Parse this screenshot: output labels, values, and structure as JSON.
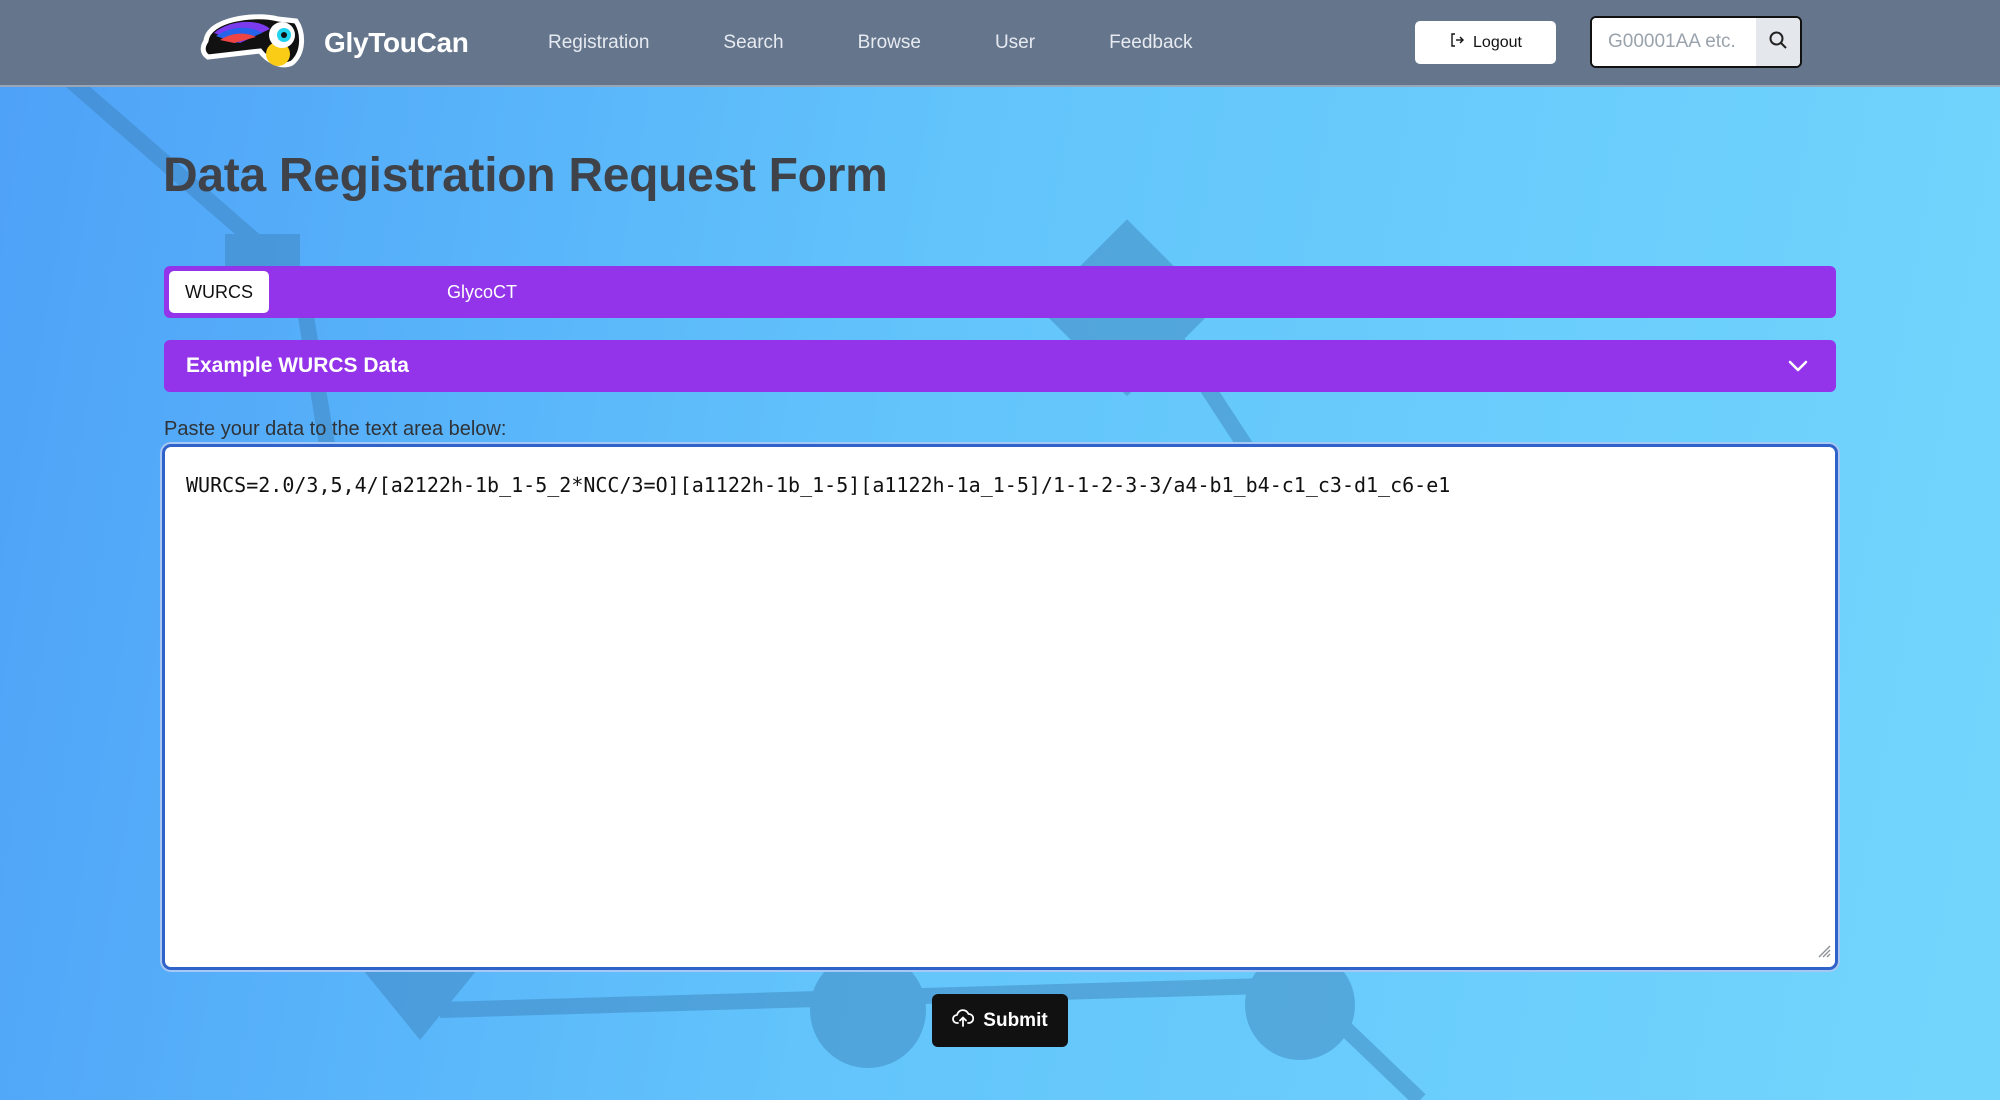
{
  "brand": {
    "name": "GlyTouCan",
    "logo_icon": "toucan-logo"
  },
  "nav": {
    "links": [
      "Registration",
      "Search",
      "Browse",
      "User",
      "Feedback"
    ],
    "logout_label": "Logout",
    "search_placeholder": "G00001AA etc."
  },
  "page": {
    "title": "Data Registration Request Form",
    "tabs": [
      {
        "label": "WURCS",
        "active": true
      },
      {
        "label": "GlycoCT",
        "active": false
      }
    ],
    "accordion_title": "Example WURCS Data",
    "paste_label": "Paste your data to the text area below:",
    "textarea_value": "WURCS=2.0/3,5,4/[a2122h-1b_1-5_2*NCC/3=O][a1122h-1b_1-5][a1122h-1a_1-5]/1-1-2-3-3/a4-b1_b4-c1_c3-d1_c6-e1",
    "submit_label": "Submit"
  },
  "colors": {
    "navbar": "#64758c",
    "accent_purple": "#9333ea",
    "submit_black": "#111111",
    "textarea_focus": "#2f63c9"
  }
}
